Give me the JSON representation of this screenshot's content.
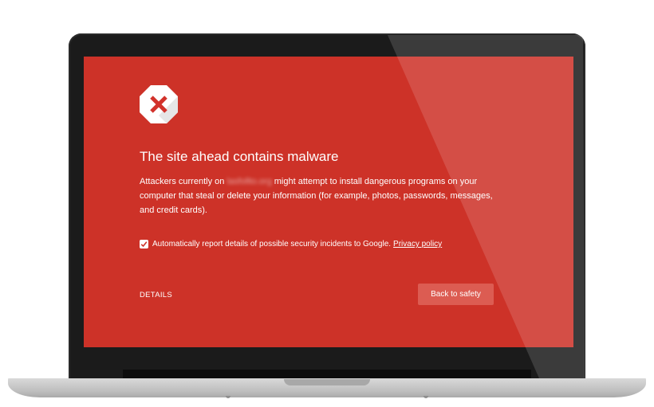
{
  "interstitial": {
    "icon": "malware-stop-icon",
    "title": "The site ahead contains malware",
    "description_before": "Attackers currently on",
    "blurred_domain": "lasfollto.org",
    "description_after": "might attempt to install dangerous programs on your computer that steal or delete your information (for example, photos, passwords, messages, and credit cards).",
    "checkbox": {
      "checked": true,
      "label": "Automatically report details of possible security incidents to Google.",
      "link_label": "Privacy policy"
    },
    "details_label": "DETAILS",
    "back_button_label": "Back to safety"
  },
  "colors": {
    "background": "#cd3228",
    "button": "#dc5c52",
    "text": "#ffffff",
    "icon_x": "#d2322b"
  }
}
